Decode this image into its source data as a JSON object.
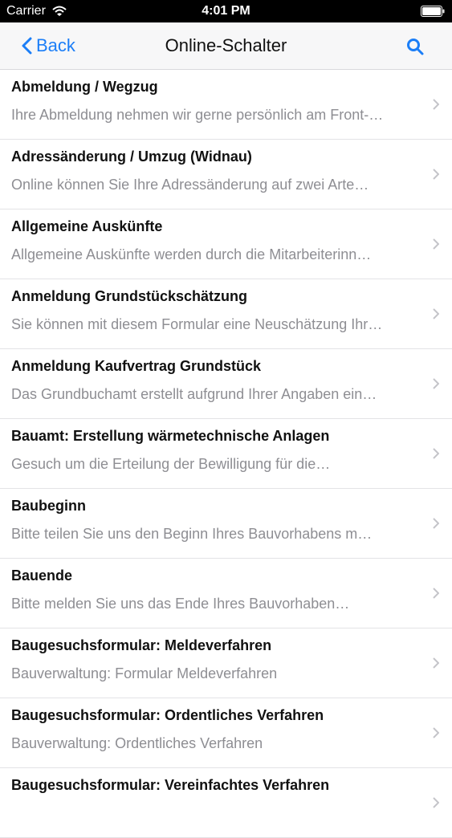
{
  "status_bar": {
    "carrier": "Carrier",
    "time": "4:01 PM",
    "icons": [
      "wifi-icon",
      "battery-icon"
    ]
  },
  "nav": {
    "back_label": "Back",
    "title": "Online-Schalter",
    "icons": [
      "chevron-left-icon",
      "search-icon"
    ],
    "accent_color": "#1b7ef7"
  },
  "items": [
    {
      "title": "Abmeldung / Wegzug",
      "subtitle": "Ihre Abmeldung nehmen wir gerne persönlich am Front-…"
    },
    {
      "title": "Adressänderung / Umzug  (Widnau)",
      "subtitle": "Online können Sie Ihre Adressänderung auf zwei Arte…"
    },
    {
      "title": "Allgemeine Auskünfte",
      "subtitle": "Allgemeine Auskünfte werden durch die Mitarbeiterinn…"
    },
    {
      "title": "Anmeldung Grundstückschätzung",
      "subtitle": "Sie können mit diesem Formular eine Neuschätzung Ihr…"
    },
    {
      "title": "Anmeldung Kaufvertrag Grundstück",
      "subtitle": "Das Grundbuchamt erstellt aufgrund Ihrer Angaben ein…"
    },
    {
      "title": "Bauamt: Erstellung wärmetechnische Anlagen",
      "subtitle": "Gesuch um die Erteilung der Bewilligung für die…"
    },
    {
      "title": "Baubeginn",
      "subtitle": "Bitte teilen Sie uns den Beginn Ihres Bauvorhabens m…"
    },
    {
      "title": "Bauende",
      "subtitle": "Bitte melden Sie uns das Ende Ihres Bauvorhaben…"
    },
    {
      "title": "Baugesuchsformular: Meldeverfahren",
      "subtitle": "Bauverwaltung: Formular Meldeverfahren"
    },
    {
      "title": "Baugesuchsformular: Ordentliches Verfahren",
      "subtitle": "Bauverwaltung: Ordentliches Verfahren"
    },
    {
      "title": "Baugesuchsformular: Vereinfachtes Verfahren",
      "subtitle": ""
    }
  ]
}
